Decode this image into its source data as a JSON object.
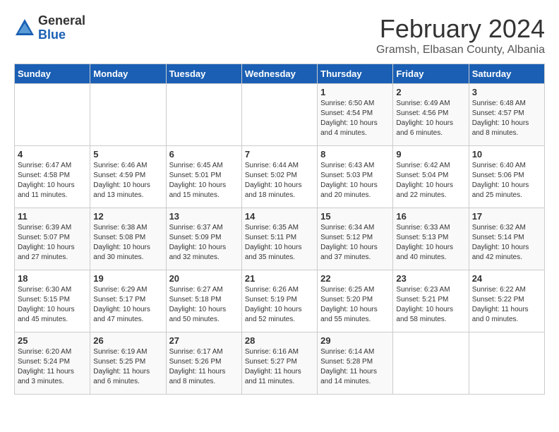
{
  "header": {
    "logo_general": "General",
    "logo_blue": "Blue",
    "month_title": "February 2024",
    "subtitle": "Gramsh, Elbasan County, Albania"
  },
  "days_of_week": [
    "Sunday",
    "Monday",
    "Tuesday",
    "Wednesday",
    "Thursday",
    "Friday",
    "Saturday"
  ],
  "weeks": [
    [
      {
        "day": "",
        "info": ""
      },
      {
        "day": "",
        "info": ""
      },
      {
        "day": "",
        "info": ""
      },
      {
        "day": "",
        "info": ""
      },
      {
        "day": "1",
        "info": "Sunrise: 6:50 AM\nSunset: 4:54 PM\nDaylight: 10 hours\nand 4 minutes."
      },
      {
        "day": "2",
        "info": "Sunrise: 6:49 AM\nSunset: 4:56 PM\nDaylight: 10 hours\nand 6 minutes."
      },
      {
        "day": "3",
        "info": "Sunrise: 6:48 AM\nSunset: 4:57 PM\nDaylight: 10 hours\nand 8 minutes."
      }
    ],
    [
      {
        "day": "4",
        "info": "Sunrise: 6:47 AM\nSunset: 4:58 PM\nDaylight: 10 hours\nand 11 minutes."
      },
      {
        "day": "5",
        "info": "Sunrise: 6:46 AM\nSunset: 4:59 PM\nDaylight: 10 hours\nand 13 minutes."
      },
      {
        "day": "6",
        "info": "Sunrise: 6:45 AM\nSunset: 5:01 PM\nDaylight: 10 hours\nand 15 minutes."
      },
      {
        "day": "7",
        "info": "Sunrise: 6:44 AM\nSunset: 5:02 PM\nDaylight: 10 hours\nand 18 minutes."
      },
      {
        "day": "8",
        "info": "Sunrise: 6:43 AM\nSunset: 5:03 PM\nDaylight: 10 hours\nand 20 minutes."
      },
      {
        "day": "9",
        "info": "Sunrise: 6:42 AM\nSunset: 5:04 PM\nDaylight: 10 hours\nand 22 minutes."
      },
      {
        "day": "10",
        "info": "Sunrise: 6:40 AM\nSunset: 5:06 PM\nDaylight: 10 hours\nand 25 minutes."
      }
    ],
    [
      {
        "day": "11",
        "info": "Sunrise: 6:39 AM\nSunset: 5:07 PM\nDaylight: 10 hours\nand 27 minutes."
      },
      {
        "day": "12",
        "info": "Sunrise: 6:38 AM\nSunset: 5:08 PM\nDaylight: 10 hours\nand 30 minutes."
      },
      {
        "day": "13",
        "info": "Sunrise: 6:37 AM\nSunset: 5:09 PM\nDaylight: 10 hours\nand 32 minutes."
      },
      {
        "day": "14",
        "info": "Sunrise: 6:35 AM\nSunset: 5:11 PM\nDaylight: 10 hours\nand 35 minutes."
      },
      {
        "day": "15",
        "info": "Sunrise: 6:34 AM\nSunset: 5:12 PM\nDaylight: 10 hours\nand 37 minutes."
      },
      {
        "day": "16",
        "info": "Sunrise: 6:33 AM\nSunset: 5:13 PM\nDaylight: 10 hours\nand 40 minutes."
      },
      {
        "day": "17",
        "info": "Sunrise: 6:32 AM\nSunset: 5:14 PM\nDaylight: 10 hours\nand 42 minutes."
      }
    ],
    [
      {
        "day": "18",
        "info": "Sunrise: 6:30 AM\nSunset: 5:15 PM\nDaylight: 10 hours\nand 45 minutes."
      },
      {
        "day": "19",
        "info": "Sunrise: 6:29 AM\nSunset: 5:17 PM\nDaylight: 10 hours\nand 47 minutes."
      },
      {
        "day": "20",
        "info": "Sunrise: 6:27 AM\nSunset: 5:18 PM\nDaylight: 10 hours\nand 50 minutes."
      },
      {
        "day": "21",
        "info": "Sunrise: 6:26 AM\nSunset: 5:19 PM\nDaylight: 10 hours\nand 52 minutes."
      },
      {
        "day": "22",
        "info": "Sunrise: 6:25 AM\nSunset: 5:20 PM\nDaylight: 10 hours\nand 55 minutes."
      },
      {
        "day": "23",
        "info": "Sunrise: 6:23 AM\nSunset: 5:21 PM\nDaylight: 10 hours\nand 58 minutes."
      },
      {
        "day": "24",
        "info": "Sunrise: 6:22 AM\nSunset: 5:22 PM\nDaylight: 11 hours\nand 0 minutes."
      }
    ],
    [
      {
        "day": "25",
        "info": "Sunrise: 6:20 AM\nSunset: 5:24 PM\nDaylight: 11 hours\nand 3 minutes."
      },
      {
        "day": "26",
        "info": "Sunrise: 6:19 AM\nSunset: 5:25 PM\nDaylight: 11 hours\nand 6 minutes."
      },
      {
        "day": "27",
        "info": "Sunrise: 6:17 AM\nSunset: 5:26 PM\nDaylight: 11 hours\nand 8 minutes."
      },
      {
        "day": "28",
        "info": "Sunrise: 6:16 AM\nSunset: 5:27 PM\nDaylight: 11 hours\nand 11 minutes."
      },
      {
        "day": "29",
        "info": "Sunrise: 6:14 AM\nSunset: 5:28 PM\nDaylight: 11 hours\nand 14 minutes."
      },
      {
        "day": "",
        "info": ""
      },
      {
        "day": "",
        "info": ""
      }
    ]
  ]
}
